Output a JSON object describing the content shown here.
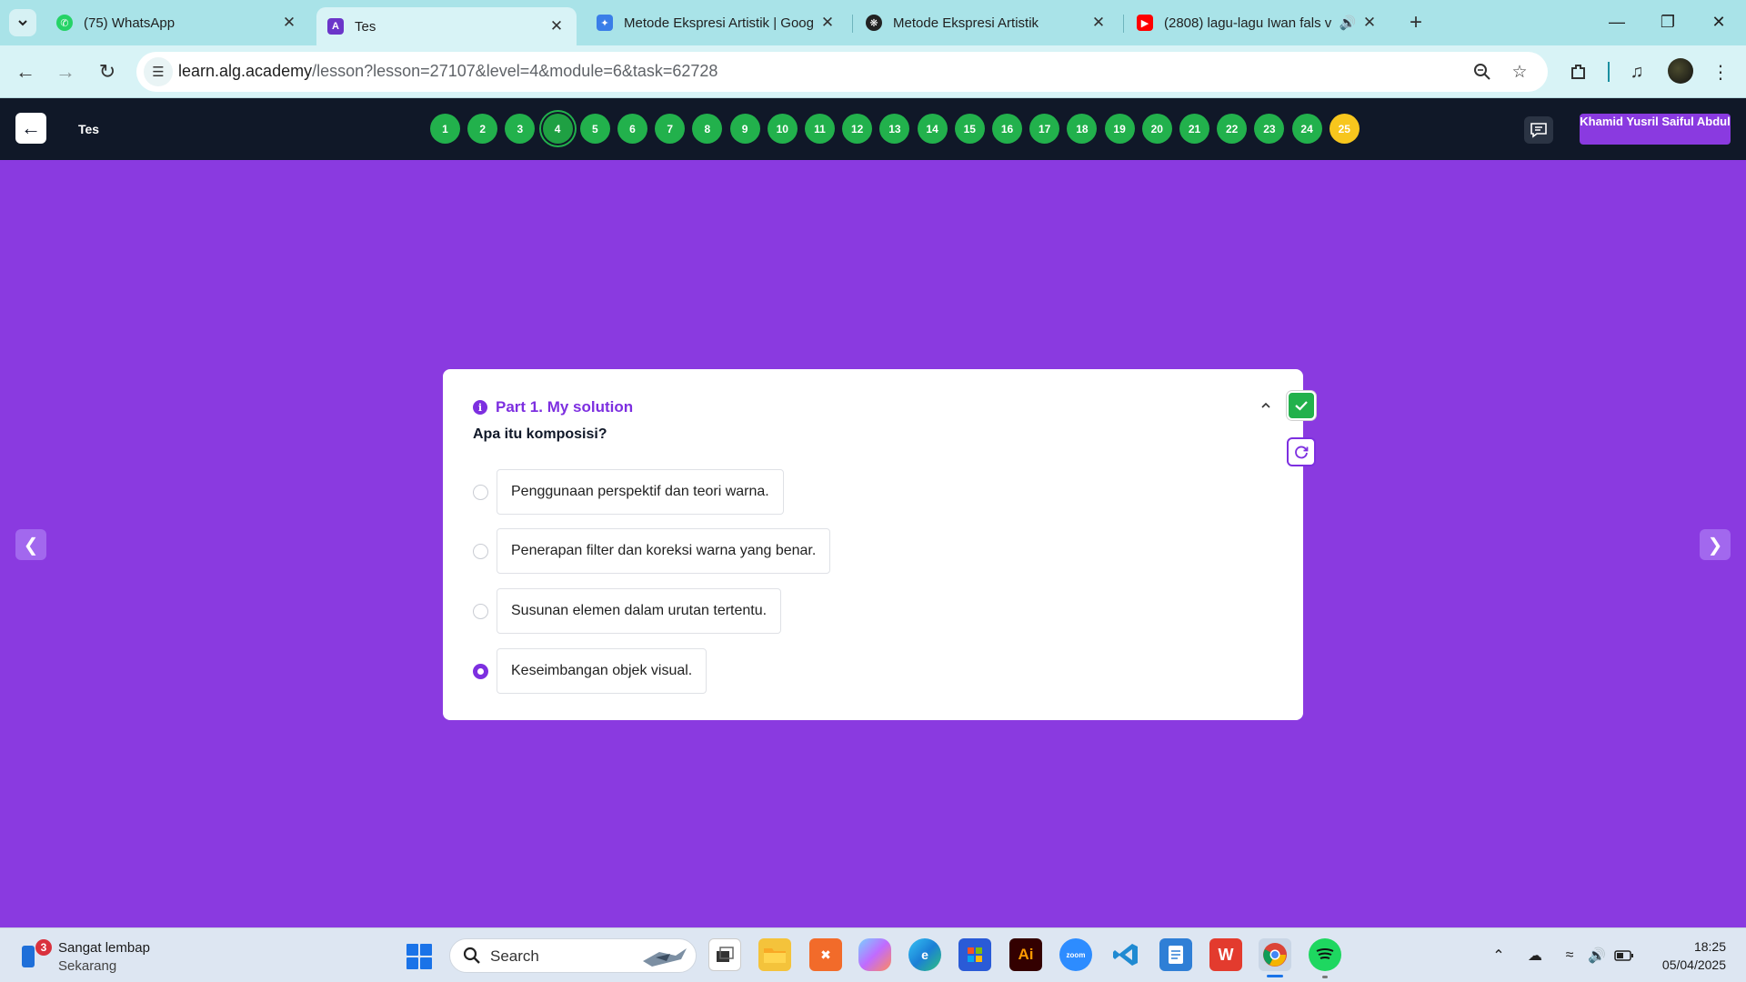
{
  "browser": {
    "tabs": [
      {
        "title": "(75) WhatsApp",
        "icon": "whatsapp-icon",
        "active": false
      },
      {
        "title": "Tes",
        "icon": "alg-academy-icon",
        "active": true
      },
      {
        "title": "Metode Ekspresi Artistik | Goog",
        "icon": "google-gemini-icon",
        "active": false
      },
      {
        "title": "Metode Ekspresi Artistik",
        "icon": "chatgpt-icon",
        "active": false
      },
      {
        "title": "(2808) lagu-lagu Iwan fals v",
        "icon": "youtube-icon",
        "active": false
      }
    ],
    "url_host": "learn.alg.academy",
    "url_path": "/lesson?lesson=27107&level=4&module=6&task=62728"
  },
  "app": {
    "title": "Tes",
    "steps": [
      "1",
      "2",
      "3",
      "4",
      "5",
      "6",
      "7",
      "8",
      "9",
      "10",
      "11",
      "12",
      "13",
      "14",
      "15",
      "16",
      "17",
      "18",
      "19",
      "20",
      "21",
      "22",
      "23",
      "24",
      "25"
    ],
    "current_step": "4",
    "highlight_step": "25",
    "user_name": "Khamid Yusril Saiful Abdul"
  },
  "quiz": {
    "part_title": "Part 1. My solution",
    "question": "Apa itu komposisi?",
    "options": [
      {
        "text": "Penggunaan perspektif dan teori warna.",
        "selected": false
      },
      {
        "text": "Penerapan filter dan koreksi warna yang benar.",
        "selected": false
      },
      {
        "text": "Susunan elemen dalam urutan tertentu.",
        "selected": false
      },
      {
        "text": "Keseimbangan objek visual.",
        "selected": true
      }
    ]
  },
  "taskbar": {
    "weather_badge": "3",
    "weather_title": "Sangat lembap",
    "weather_sub": "Sekarang",
    "search_placeholder": "Search",
    "time": "18:25",
    "date": "05/04/2025"
  },
  "colors": {
    "page_bg": "#8a3ae0",
    "accent": "#7d2fe0",
    "step_done": "#22b14c",
    "step_highlight": "#f7c61d",
    "header_bg": "#101828"
  }
}
